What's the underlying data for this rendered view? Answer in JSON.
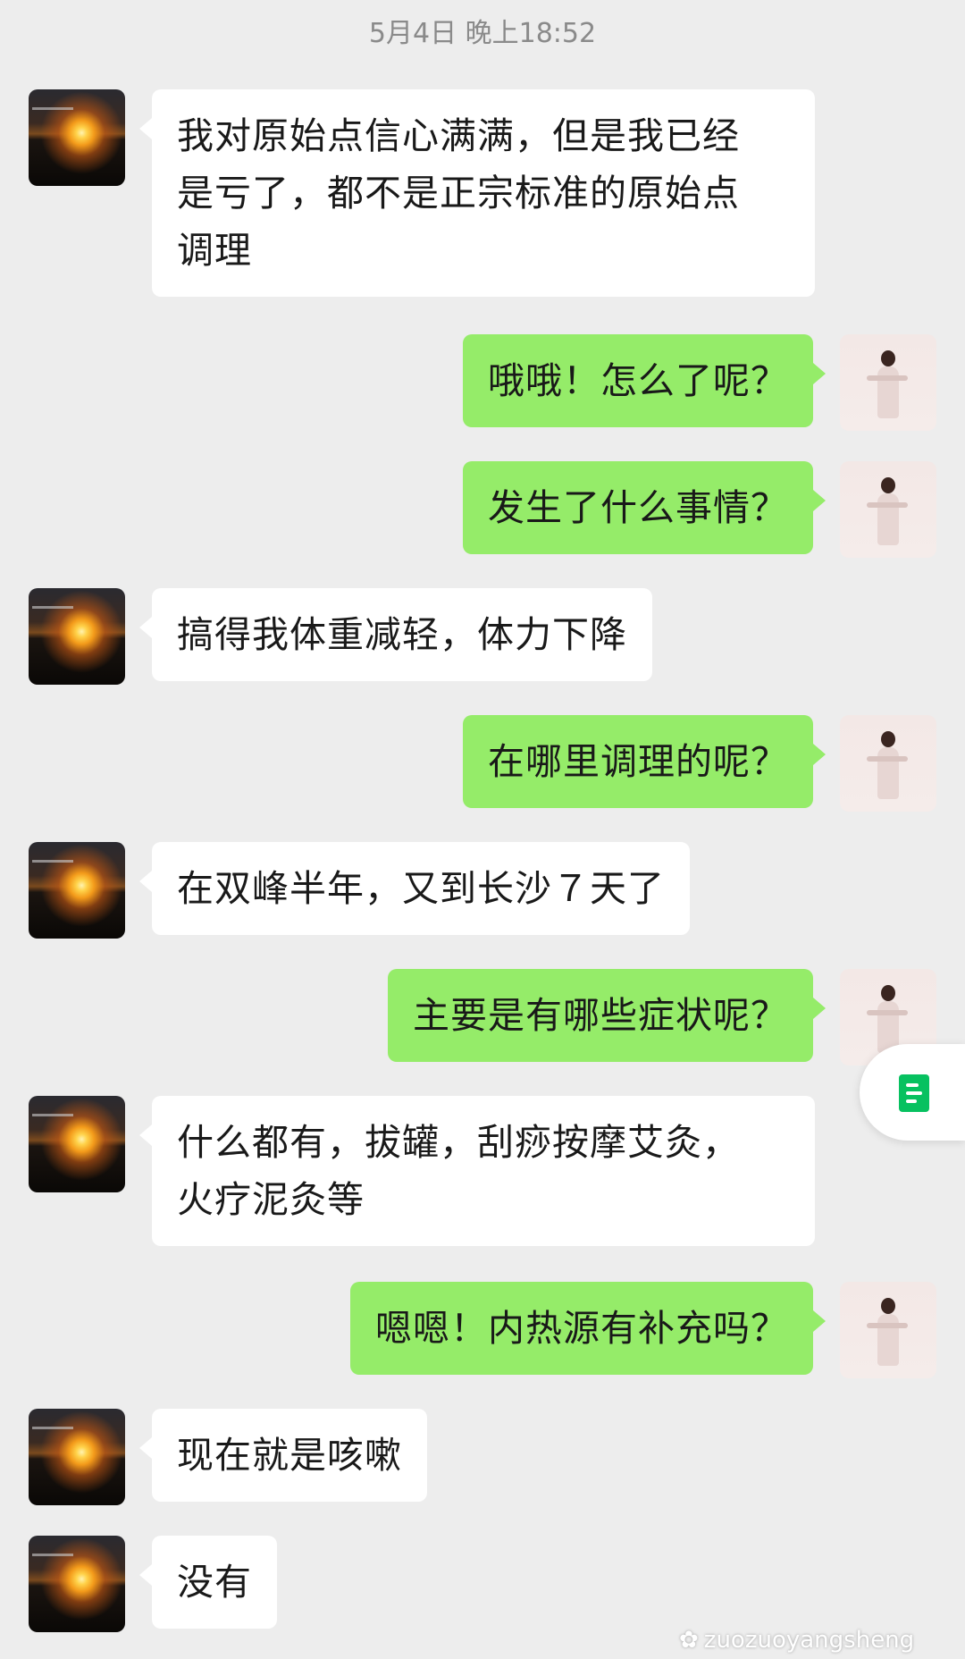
{
  "timestamp": "5月4日 晚上18:52",
  "messages": [
    {
      "side": "left",
      "avatar": "sunset-avatar",
      "text": "我对原始点信心满满，但是我已经\n是亏了，都不是正宗标准的原始点\n调理"
    },
    {
      "side": "right",
      "avatar": "person-avatar",
      "text": "哦哦！怎么了呢？"
    },
    {
      "side": "right",
      "avatar": "person-avatar",
      "text": "发生了什么事情？"
    },
    {
      "side": "left",
      "avatar": "sunset-avatar",
      "text": "搞得我体重减轻，体力下降"
    },
    {
      "side": "right",
      "avatar": "person-avatar",
      "text": "在哪里调理的呢？"
    },
    {
      "side": "left",
      "avatar": "sunset-avatar",
      "text": "在双峰半年，又到长沙７天了"
    },
    {
      "side": "right",
      "avatar": "person-avatar",
      "text": "主要是有哪些症状呢？"
    },
    {
      "side": "left",
      "avatar": "sunset-avatar",
      "text": "什么都有，拔罐，刮痧按摩艾灸，\n火疗泥灸等"
    },
    {
      "side": "right",
      "avatar": "person-avatar",
      "text": "嗯嗯！内热源有补充吗？"
    },
    {
      "side": "left",
      "avatar": "sunset-avatar",
      "text": "现在就是咳嗽"
    },
    {
      "side": "left",
      "avatar": "sunset-avatar",
      "text": "没有"
    }
  ],
  "floating_button": {
    "icon": "document-icon"
  },
  "watermark": {
    "text": "zuozuoyangsheng",
    "icon": "wechat-official-account-icon"
  },
  "colors": {
    "background": "#ededed",
    "incoming_bubble": "#ffffff",
    "outgoing_bubble": "#95ec69",
    "accent": "#07c160"
  }
}
